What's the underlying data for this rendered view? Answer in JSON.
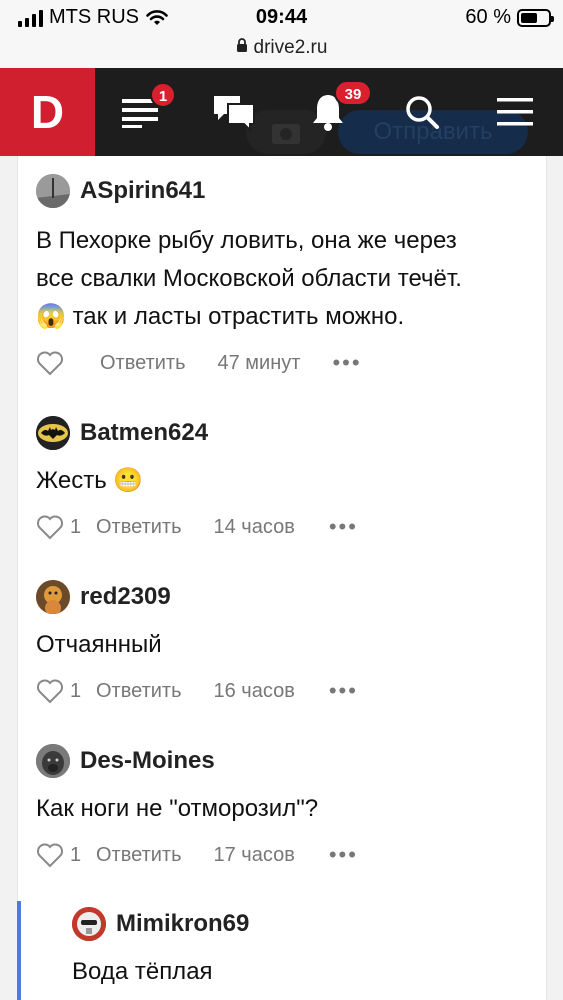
{
  "status_bar": {
    "carrier": "MTS RUS",
    "time": "09:44",
    "battery": "60 %",
    "battery_level": 0.6
  },
  "browser": {
    "url": "drive2.ru"
  },
  "nav": {
    "logo": "D",
    "feed_badge": "1",
    "notifications_badge": "39",
    "ghost_send_label": "Отправить",
    "icons": [
      "feed-icon",
      "messages-icon",
      "bell-icon",
      "search-icon",
      "menu-icon"
    ]
  },
  "colors": {
    "brand": "#d0202f",
    "navbar": "#1d1d1d",
    "badge": "#d8202f",
    "thread_bar": "#4a7fd9"
  },
  "comments": [
    {
      "author": "ASpirin641",
      "lines": [
        "В Пехорке рыбу ловить, она же через",
        "все свалки Московской области течёт.",
        "так и ласты отрастить можно."
      ],
      "emoji": "😱",
      "likes": "",
      "reply": "Ответить",
      "time": "47 минут",
      "more": "•••"
    },
    {
      "author": "Batmen624",
      "lines": [
        "Жесть"
      ],
      "emoji": "😬",
      "likes": "1",
      "reply": "Ответить",
      "time": "14 часов",
      "more": "•••"
    },
    {
      "author": "red2309",
      "lines": [
        "Отчаянный"
      ],
      "likes": "1",
      "reply": "Ответить",
      "time": "16 часов",
      "more": "•••"
    },
    {
      "author": "Des-Moines",
      "lines": [
        "Как ноги не \"отморозил\"?"
      ],
      "likes": "1",
      "reply": "Ответить",
      "time": "17 часов",
      "more": "•••"
    }
  ],
  "reply": {
    "author": "Mimikron69",
    "text": "Вода тёплая"
  }
}
